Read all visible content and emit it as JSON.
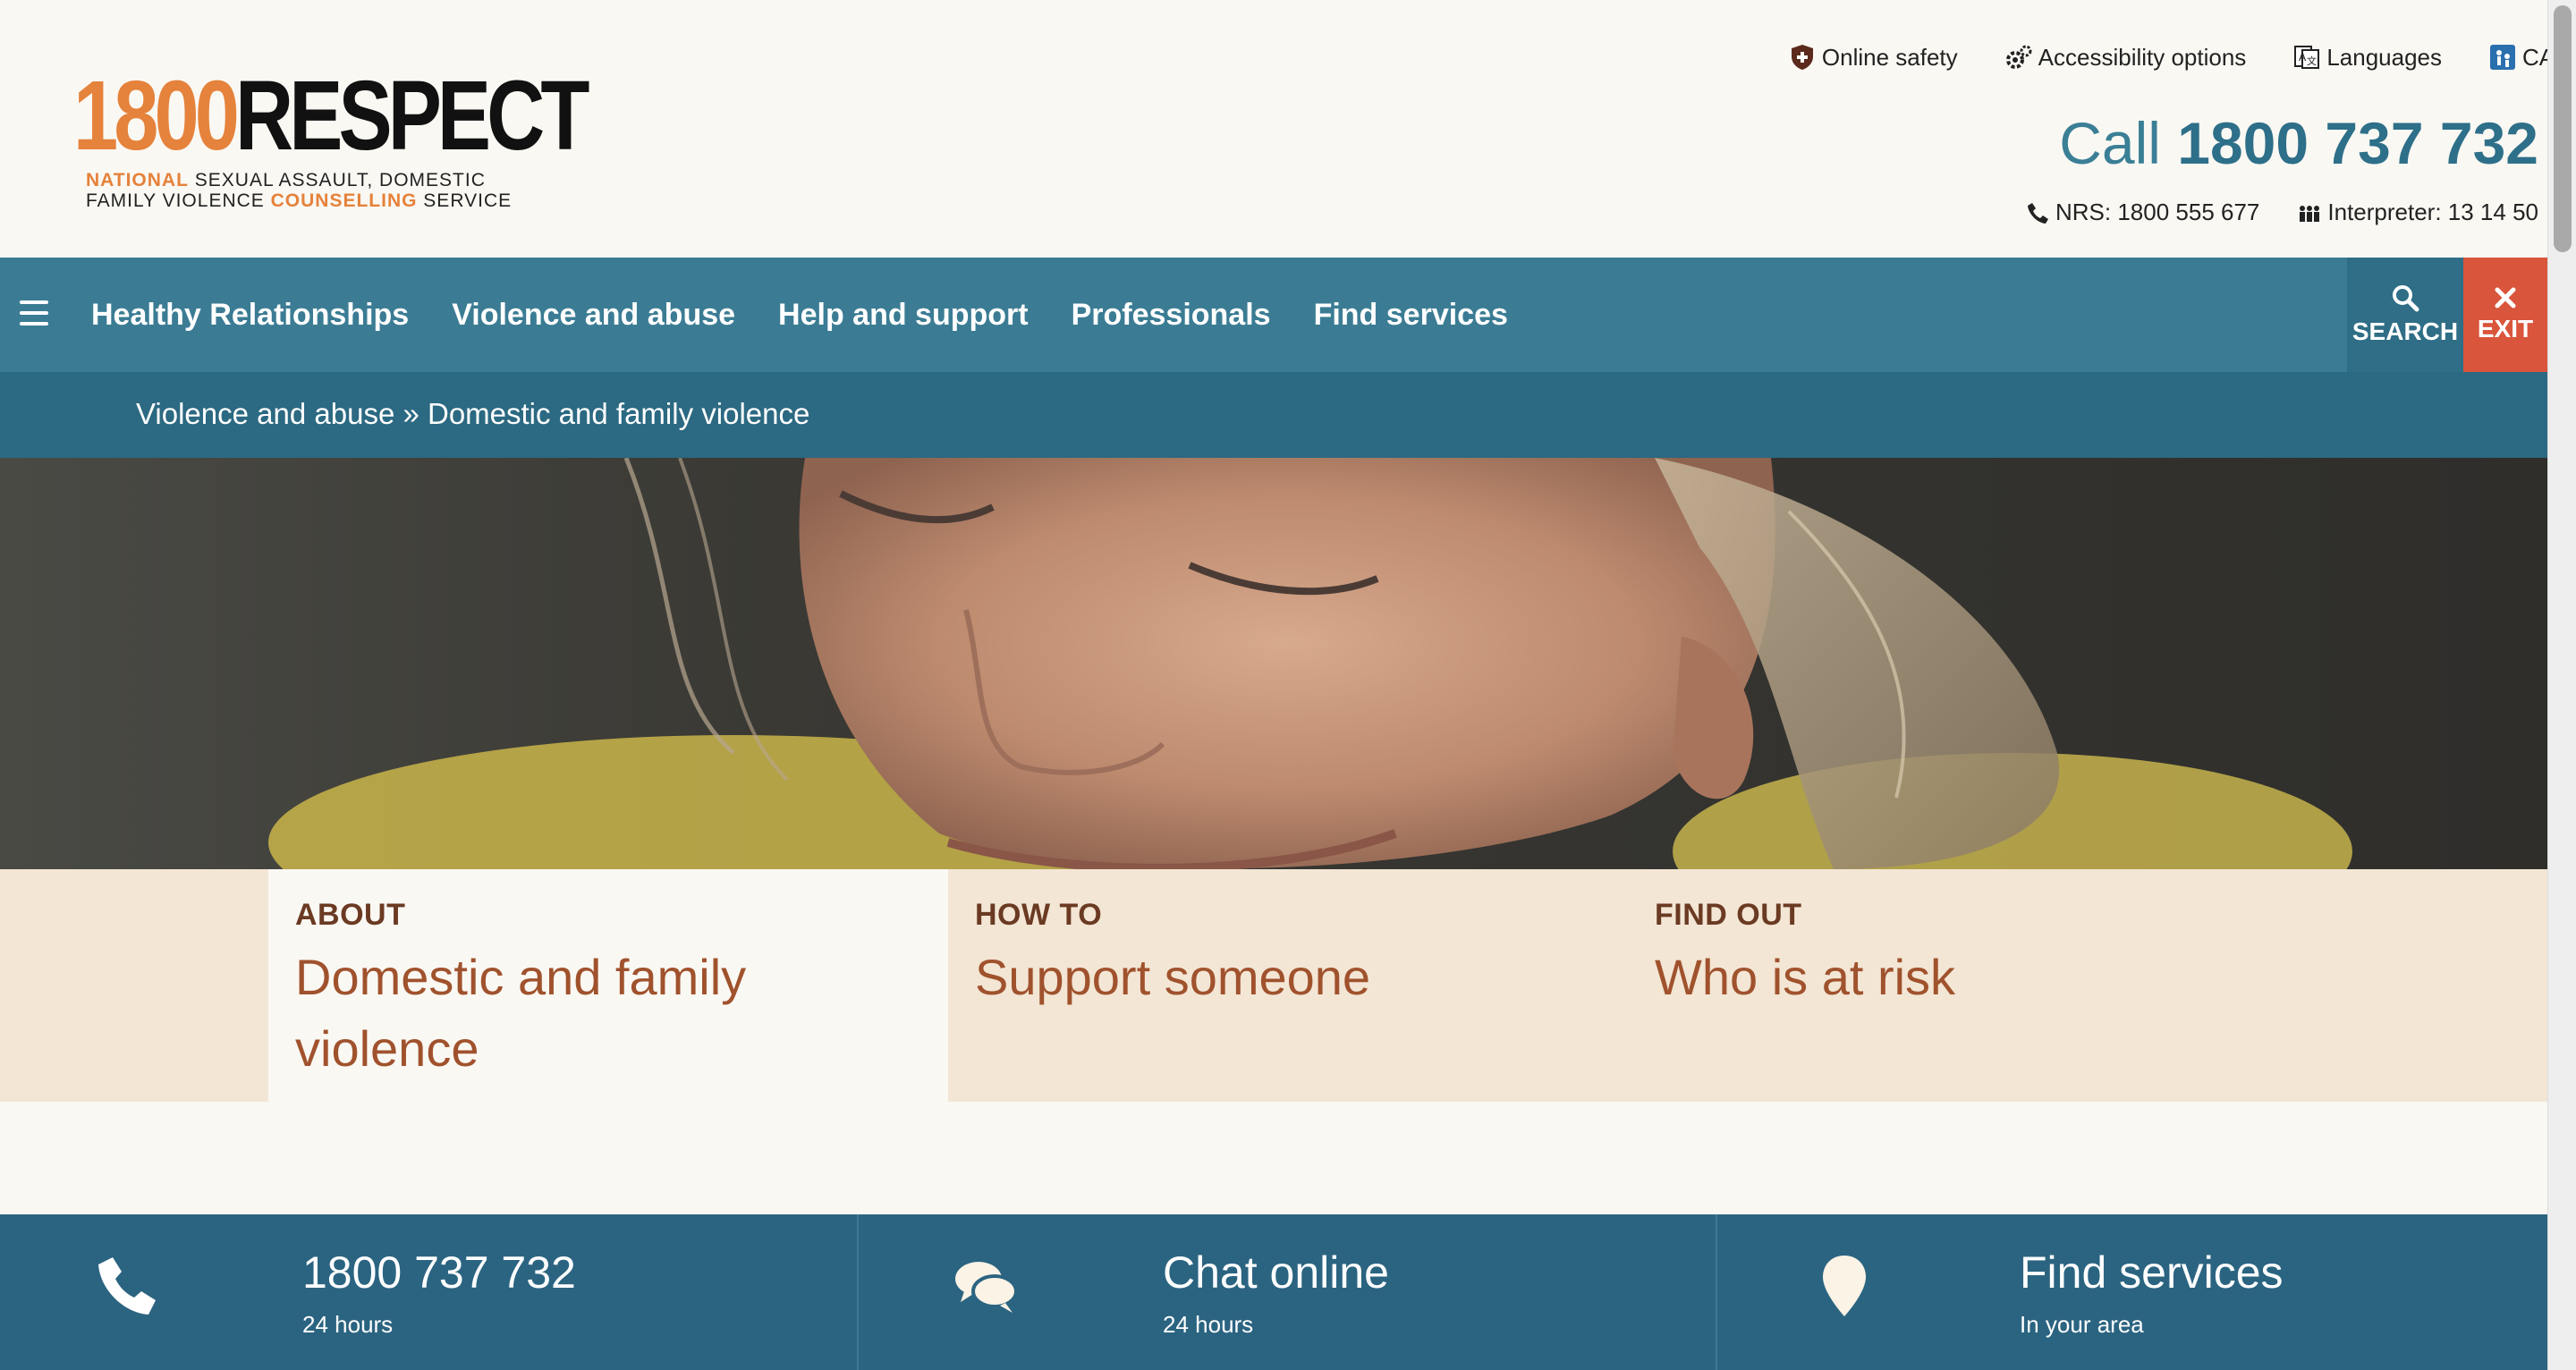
{
  "logo": {
    "number": "1800",
    "word": "RESPECT",
    "line1_highlight": "NATIONAL",
    "line1_rest": " SEXUAL ASSAULT, DOMESTIC",
    "line2_start": "FAMILY VIOLENCE ",
    "line2_highlight": "COUNSELLING",
    "line2_end": " SERVICE"
  },
  "utility": {
    "online_safety": "Online safety",
    "accessibility": "Accessibility options",
    "languages": "Languages",
    "cald": "CALD"
  },
  "call": {
    "prefix": "Call",
    "number": "1800 737 732"
  },
  "contacts": {
    "nrs": "NRS: 1800 555 677",
    "interpreter": "Interpreter: 13 14 50"
  },
  "nav": {
    "items": [
      "Healthy Relationships",
      "Violence and abuse",
      "Help and support",
      "Professionals",
      "Find services"
    ],
    "search_label": "SEARCH",
    "exit_label": "EXIT"
  },
  "breadcrumb": "Violence and abuse » Domestic and family violence",
  "tabs": [
    {
      "kicker": "ABOUT",
      "title": "Domestic and family violence"
    },
    {
      "kicker": "HOW TO",
      "title": "Support someone"
    },
    {
      "kicker": "FIND OUT",
      "title": "Who is at risk"
    }
  ],
  "bottom": [
    {
      "main": "1800 737 732",
      "sub": "24 hours",
      "icon": "phone-icon"
    },
    {
      "main": "Chat online",
      "sub": "24 hours",
      "icon": "chat-icon"
    },
    {
      "main": "Find services",
      "sub": "In your area",
      "icon": "location-pin-icon"
    }
  ],
  "colors": {
    "nav": "#3b7c94",
    "breadcrumb": "#2c6982",
    "exit": "#d9553b",
    "accent_orange": "#e5823b",
    "tab_title": "#a0522d",
    "bottom_bar": "#2b6481"
  }
}
